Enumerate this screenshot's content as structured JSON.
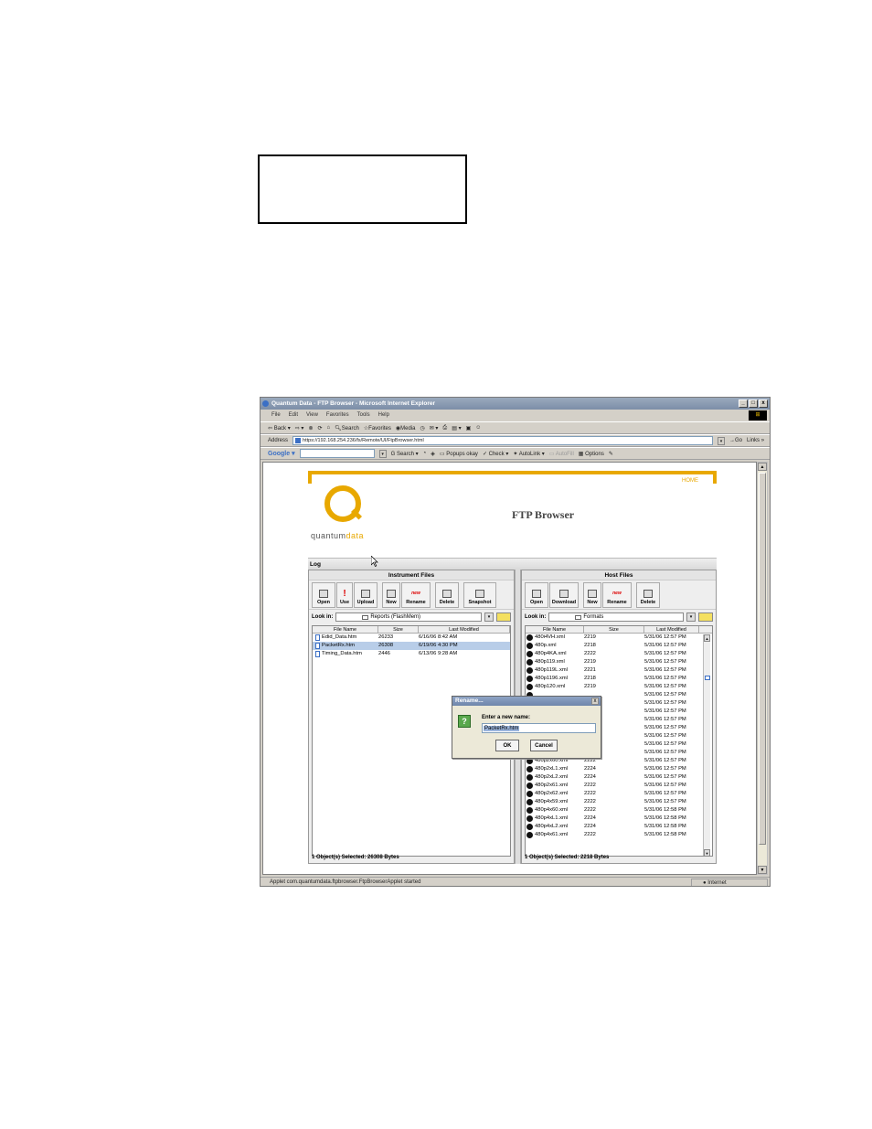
{
  "window": {
    "title": "Quantum Data - FTP Browser - Microsoft Internet Explorer",
    "controls": [
      "_",
      "□",
      "x"
    ]
  },
  "menu": [
    "File",
    "Edit",
    "View",
    "Favorites",
    "Tools",
    "Help"
  ],
  "nav_toolbar": {
    "back": "Back",
    "search": "Search",
    "favorites": "Favorites",
    "media": "Media"
  },
  "address_bar": {
    "label": "Address",
    "url": "https://192.168.254.236/fs/Remote/UI/FtpBrowser.html",
    "go": "Go",
    "links": "Links"
  },
  "google_toolbar": {
    "logo": "Google",
    "search": "Search",
    "popups": "Popups okay",
    "check": "Check",
    "autolink": "AutoLink",
    "autofill": "AutoFill",
    "options": "Options"
  },
  "page": {
    "home_link": "HOME",
    "logo_main": "quantum",
    "logo_accent": "data",
    "title": "FTP Browser",
    "log_label": "Log"
  },
  "instrument_panel": {
    "header": "Instrument Files",
    "tools": [
      "Open",
      "Use",
      "Upload",
      "New",
      "Rename",
      "Delete",
      "Snapshot"
    ],
    "new_badge": "new",
    "look_in_label": "Look in:",
    "look_in_value": "Reports  (FlashMem)",
    "columns": [
      "File Name",
      "Size",
      "Last Modified"
    ],
    "files": [
      {
        "name": "Edid_Data.htm",
        "size": "26233",
        "modified": "6/16/06 8:42 AM"
      },
      {
        "name": "PacketRx.htm",
        "size": "26308",
        "modified": "6/19/06 4:30 PM"
      },
      {
        "name": "Timing_Data.htm",
        "size": "2446",
        "modified": "6/13/06 9:28 AM"
      }
    ],
    "selected_index": 1,
    "status": "1 Object(s) Selected:  26308 Bytes"
  },
  "host_panel": {
    "header": "Host Files",
    "tools": [
      "Open",
      "Download",
      "New",
      "Rename",
      "Delete"
    ],
    "look_in_label": "Look in:",
    "look_in_value": "Formats",
    "columns": [
      "File Name",
      "Size",
      "Last Modified"
    ],
    "files": [
      {
        "name": "480i4VH.xml",
        "size": "2219",
        "modified": "5/31/06 12:57 PM"
      },
      {
        "name": "480p.xml",
        "size": "2218",
        "modified": "5/31/06 12:57 PM"
      },
      {
        "name": "480p4KA.xml",
        "size": "2222",
        "modified": "5/31/06 12:57 PM"
      },
      {
        "name": "480p119.xml",
        "size": "2219",
        "modified": "5/31/06 12:57 PM"
      },
      {
        "name": "480p119L.xml",
        "size": "2221",
        "modified": "5/31/06 12:57 PM"
      },
      {
        "name": "480p1196.xml",
        "size": "2218",
        "modified": "5/31/06 12:57 PM"
      },
      {
        "name": "480p120.xml",
        "size": "2219",
        "modified": "5/31/06 12:57 PM"
      },
      {
        "name": "",
        "size": "",
        "modified": "5/31/06 12:57 PM"
      },
      {
        "name": "",
        "size": "",
        "modified": "5/31/06 12:57 PM"
      },
      {
        "name": "",
        "size": "",
        "modified": "5/31/06 12:57 PM"
      },
      {
        "name": "",
        "size": "",
        "modified": "5/31/06 12:57 PM"
      },
      {
        "name": "",
        "size": "",
        "modified": "5/31/06 12:57 PM"
      },
      {
        "name": "",
        "size": "",
        "modified": "5/31/06 12:57 PM"
      },
      {
        "name": "480p240.xml",
        "size": "2219",
        "modified": "5/31/06 12:57 PM"
      },
      {
        "name": "480p2x59.xml",
        "size": "2222",
        "modified": "5/31/06 12:57 PM"
      },
      {
        "name": "480p2x60.xml",
        "size": "2222",
        "modified": "5/31/06 12:57 PM"
      },
      {
        "name": "480p2xL1.xml",
        "size": "2224",
        "modified": "5/31/06 12:57 PM"
      },
      {
        "name": "480p2xL2.xml",
        "size": "2224",
        "modified": "5/31/06 12:57 PM"
      },
      {
        "name": "480p2x61.xml",
        "size": "2222",
        "modified": "5/31/06 12:57 PM"
      },
      {
        "name": "480p2x62.xml",
        "size": "2222",
        "modified": "5/31/06 12:57 PM"
      },
      {
        "name": "480p4x59.xml",
        "size": "2222",
        "modified": "5/31/06 12:57 PM"
      },
      {
        "name": "480p4x60.xml",
        "size": "2222",
        "modified": "5/31/06 12:58 PM"
      },
      {
        "name": "480p4xL1.xml",
        "size": "2224",
        "modified": "5/31/06 12:58 PM"
      },
      {
        "name": "480p4xL2.xml",
        "size": "2224",
        "modified": "5/31/06 12:58 PM"
      },
      {
        "name": "480p4x61.xml",
        "size": "2222",
        "modified": "5/31/06 12:58 PM"
      }
    ],
    "status": "1 Object(s) Selected:  2218 Bytes"
  },
  "rename_dialog": {
    "title": "Rename...",
    "close": "x",
    "icon": "?",
    "prompt": "Enter a new name:",
    "value": "PacketRx.htm",
    "ok": "OK",
    "cancel": "Cancel"
  },
  "status_bar": {
    "text": "Applet com.quantumdata.ftpbrowser.FtpBrowserApplet started",
    "zone": "Internet"
  }
}
